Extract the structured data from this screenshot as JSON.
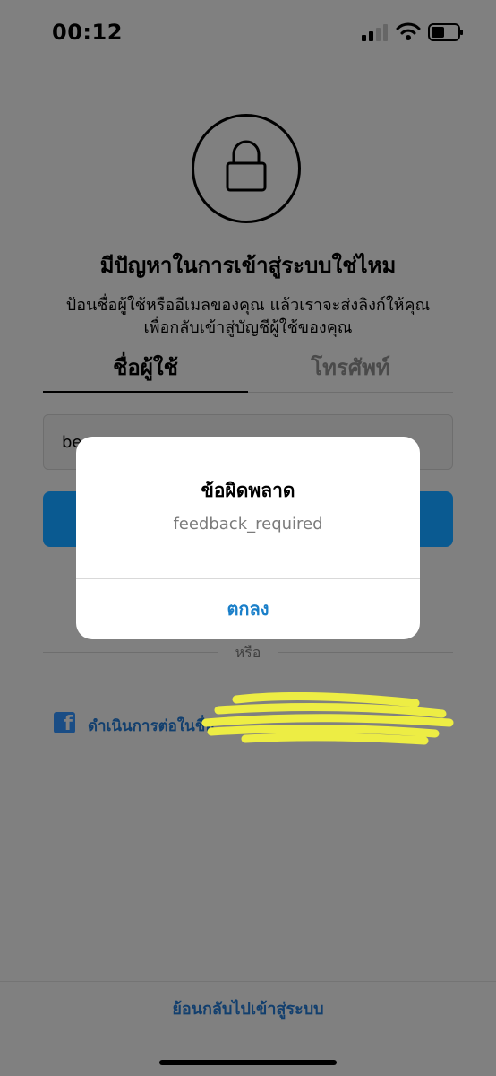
{
  "status_bar": {
    "time": "00:12",
    "signal_icon": "cellular-signal-icon",
    "wifi_icon": "wifi-icon",
    "battery_icon": "battery-icon"
  },
  "header": {
    "icon": "lock-icon",
    "title": "มีปัญหาในการเข้าสู่ระบบใช่ไหม",
    "description": "ป้อนชื่อผู้ใช้หรืออีเมลของคุณ แล้วเราจะส่งลิงก์ให้คุณเพื่อกลับเข้าสู่บัญชีผู้ใช้ของคุณ"
  },
  "tabs": [
    {
      "label": "ชื่อผู้ใช้",
      "selected": true
    },
    {
      "label": "โทรศัพท์",
      "selected": false
    }
  ],
  "username_input": {
    "value": "be"
  },
  "divider": {
    "label": "หรือ"
  },
  "facebook": {
    "icon": "facebook-icon",
    "label": "ดำเนินการต่อในชื่อ"
  },
  "footer": {
    "back_link": "ย้อนกลับไปเข้าสู่ระบบ"
  },
  "alert": {
    "title": "ข้อผิดพลาด",
    "message": "feedback_required",
    "button": "ตกลง"
  },
  "colors": {
    "overlay_background": "#808080",
    "primary_button": "#0a5a91",
    "alert_button_text": "#1a7fc9",
    "redaction_marker": "#eded44"
  }
}
